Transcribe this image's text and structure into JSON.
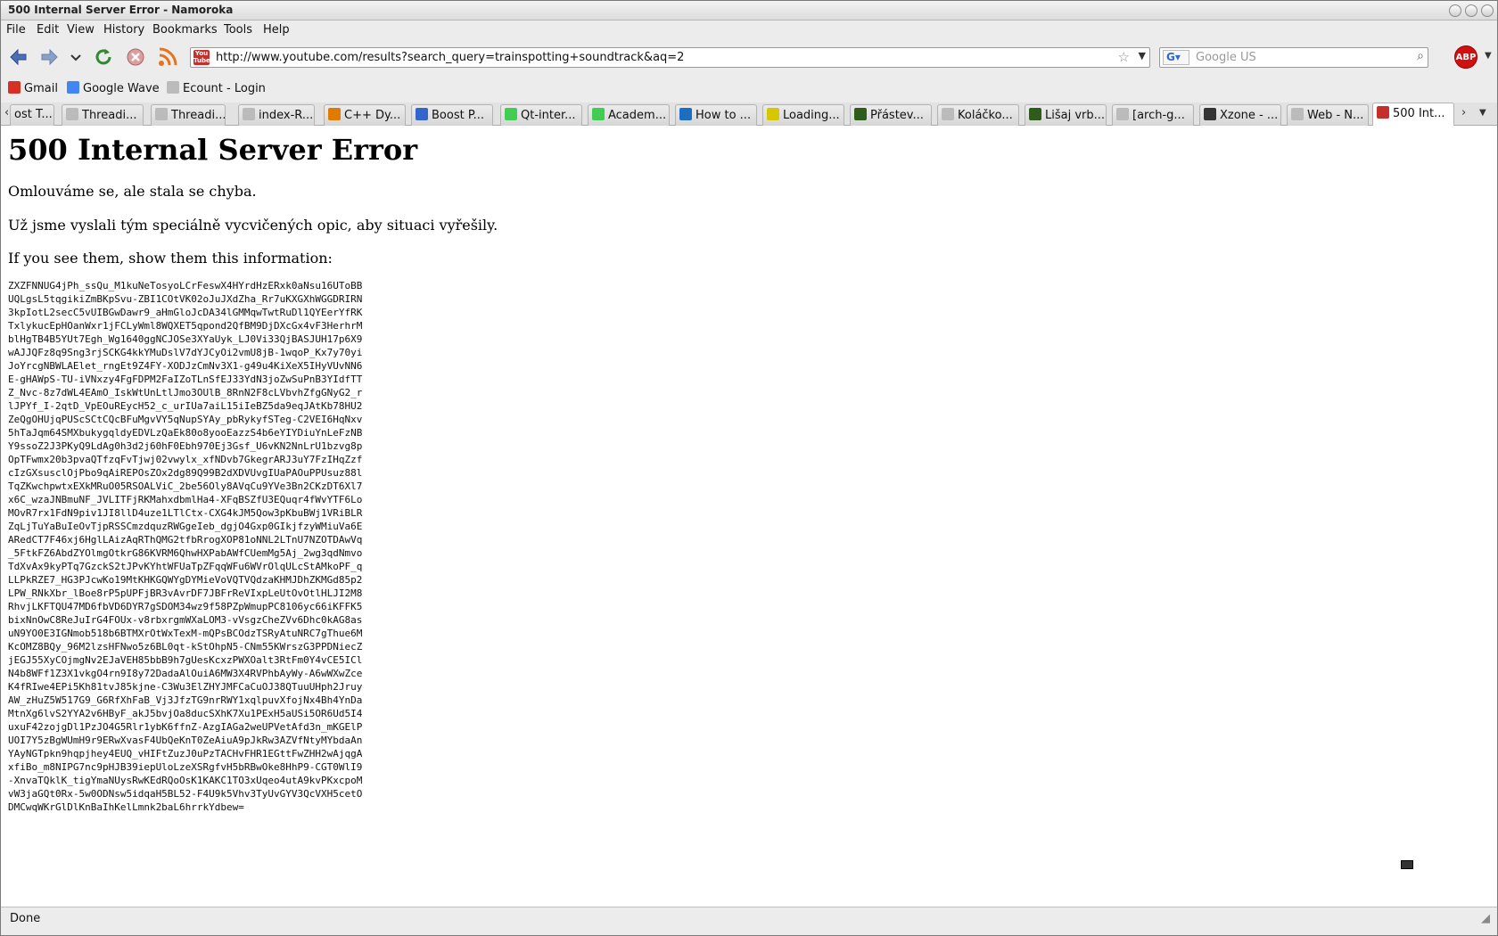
{
  "window": {
    "title": "500 Internal Server Error - Namoroka"
  },
  "menu": {
    "file": "File",
    "edit": "Edit",
    "view": "View",
    "history": "History",
    "bookmarks": "Bookmarks",
    "tools": "Tools",
    "help": "Help"
  },
  "nav": {
    "url": "http://www.youtube.com/results?search_query=trainspotting+soundtrack&aq=2",
    "search_placeholder": "Google US",
    "adblock_label": "ABP"
  },
  "bookmarks": [
    {
      "label": "Gmail",
      "icon": "gmail-icon",
      "color": "#d93025"
    },
    {
      "label": "Google Wave",
      "icon": "google-wave-icon",
      "color": "#4285f4"
    },
    {
      "label": "Ecount - Login",
      "icon": "page-icon",
      "color": "#888888"
    }
  ],
  "tabs": [
    {
      "label": "ost T...",
      "icon": "page-icon",
      "color": "#888888"
    },
    {
      "label": "Threadi...",
      "icon": "page-icon",
      "color": "#888888"
    },
    {
      "label": "Threadi...",
      "icon": "page-icon",
      "color": "#888888"
    },
    {
      "label": "index-R...",
      "icon": "page-icon",
      "color": "#888888"
    },
    {
      "label": "C++ Dy...",
      "icon": "stack-icon",
      "color": "#e07b00"
    },
    {
      "label": "Boost P...",
      "icon": "boost-icon",
      "color": "#3366cc"
    },
    {
      "label": "Qt-inter...",
      "icon": "qt-icon",
      "color": "#41cd52"
    },
    {
      "label": "Academ...",
      "icon": "qt-icon",
      "color": "#41cd52"
    },
    {
      "label": "How to ...",
      "icon": "kde-icon",
      "color": "#1d6dc2"
    },
    {
      "label": "Loading...",
      "icon": "loading-icon",
      "color": "#d8c600"
    },
    {
      "label": "Přástev...",
      "icon": "site-icon",
      "color": "#2e5d1b"
    },
    {
      "label": "Koláčko...",
      "icon": "page-icon",
      "color": "#888888"
    },
    {
      "label": "Lišaj vrb...",
      "icon": "site-icon",
      "color": "#2e5d1b"
    },
    {
      "label": "[arch-g...",
      "icon": "page-icon",
      "color": "#888888"
    },
    {
      "label": "Xzone - ...",
      "icon": "xzone-icon",
      "color": "#333333"
    },
    {
      "label": "Web - N...",
      "icon": "page-icon",
      "color": "#888888"
    },
    {
      "label": "500 Int...",
      "icon": "youtube-icon",
      "color": "#c4302b"
    }
  ],
  "page": {
    "heading": "500 Internal Server Error",
    "p1": "Omlouváme se, ale stala se chyba.",
    "p2": "Už jsme vyslali tým speciálně vycvičených opic, aby situaci vyřešily.",
    "p3": "If you see them, show them this information:",
    "code": "ZXZFNNUG4jPh_ssQu_M1kuNeTosyoLCrFeswX4HYrdHzERxk0aNsu16UToBB\nUQLgsL5tqgikiZmBKpSvu-ZBI1COtVK02oJuJXdZha_Rr7uKXGXhWGGDRIRN\n3kpIotL2secC5vUIBGwDawr9_aHmGloJcDA34lGMMqwTwtRuDl1QYEerYfRK\nTxlykucEpHOanWxr1jFCLyWml8WQXET5qpond2QfBM9DjDXcGx4vF3HerhrM\nblHgTB4B5YUt7Egh_Wg1640ggNCJOSe3XYaUyk_LJ0Vi33QjBASJUH17p6X9\nwAJJQFz8q9Sng3rjSCKG4kkYMuDslV7dYJCyOi2vmU8jB-1wqoP_Kx7y70yi\nJoYrcgNBWLAElet_rngEt9Z4FY-XODJzCmNv3X1-g49u4KiXeX5IHyVUvNN6\nE-gHAWpS-TU-iVNxzy4FgFDPM2FaIZoTLnSfEJ33YdN3joZwSuPnB3YIdfTT\nZ_Nvc-8z7dWL4EAmO_IskWtUnLtlJmo3OUlB_8RnN2F8cLVbvhZfgGNyG2_r\nlJPYf_I-2qtD_VpEOuREycH52_c_urIUa7aiL15iIeBZ5da9eqJAtKb78HU2\nZeQgOHUjqPUScSCtCQcBFuMgvVY5qNupSYAy_pbRykyfSTeg-C2VEI6HqNxv\n5hTaJqm64SMXbukygqldyEDVLzQaEk80o8yooEazzS4b6eYIYDiuYnLeFzNB\nY9ssoZ2J3PKyQ9LdAg0h3d2j60hF0Ebh970Ej3Gsf_U6vKN2NnLrU1bzvg8p\nOpTFwmx20b3pvaQTfzqFvTjwj02vwylx_xfNDvb7GkegrARJ3uY7FzIHqZzf\ncIzGXsusclOjPbo9qAiREPOsZOx2dg89Q99B2dXDVUvgIUaPAOuPPUsuz88l\nTqZKwchpwtxEXkMRuO05RSOALViC_2be56Oly8AVqCu9YVe3Bn2CKzDT6Xl7\nx6C_wzaJNBmuNF_JVLITFjRKMahxdbmlHa4-XFqBSZfU3EQuqr4fWvYTF6Lo\nMOvR7rx1FdN9piv1JI8llD4uze1LTlCtx-CXG4kJM5Qow3pKbuBWj1VRiBLR\nZqLjTuYaBuIeOvTjpRSSCmzdquzRWGgeIeb_dgjO4Gxp0GIkjfzyWMiuVa6E\nARedCT7F46xj6HglLAizAqRThQMG2tfbRrogXOP81oNNL2LTnU7NZOTDAwVq\n_5FtkFZ6AbdZYOlmgOtkrG86KVRM6QhwHXPabAWfCUemMg5Aj_2wg3qdNmvo\nTdXvAx9kyPTq7GzckS2tJPvKYhtWFUaTpZFqqWFu6WVrOlqULcStAMkoPF_q\nLLPkRZE7_HG3PJcwKo19MtKHKGQWYgDYMieVoVQTVQdzaKHMJDhZKMGd85p2\nLPW_RNkXbr_lBoe8rP5pUPFjBR3vAvrDF7JBFrReVIxpLeUtOvOtlHLJI2M8\nRhvjLKFTQU47MD6fbVD6DYR7gSDOM34wz9f58PZpWmupPC8106yc66iKFFK5\nbixNnOwC8ReJuIrG4FOUx-v8rbxrgmWXaLOM3-vVsgzCheZVv6Dhc0kAG8as\nuN9YO0E3IGNmob518b6BTMXrOtWxTexM-mQPsBCOdzTSRyAtuNRC7gThue6M\nKcOMZ8BQy_96M2lzsHFNwo5z6BL0qt-kStOhpN5-CNm55KWrszG3PPDNiecZ\njEGJ55XyCOjmgNv2EJaVEH85bbB9h7gUesKcxzPWXOalt3RtFm0Y4vCE5ICl\nN4b8WFf1Z3X1vkgO4rn9I8y72DadaAlOuiA6MW3X4RVPhbAyWy-A6wWXwZce\nK4fRIwe4EPi5Kh81tvJ85kjne-C3Wu3ElZHYJMFCaCuOJ38QTuuUHph2Jruy\nAW_zHuZ5W517G9_G6RfXhFaB_Vj3JfzTG9nrRWY1xqlpuvXfojNx4Bh4YnDa\nMtnXg6lvS2YYA2v6HByF_akJ5bvjOa8ducSXhK7Xu1PExH5aUSi5OR6Ud5I4\nuxuF42zojgDl1PzJO4G5Rlr1ybK6ffnZ-AzgIAGa2weUPVetAfd3n_mKGElP\nUOI7Y5zBgWUmH9r9ERwXvasF4UbQeKnT0ZeAiuA9pJkRw3AZVfNtyMYbdaAn\nYAyNGTpkn9hqpjhey4EUQ_vHIFtZuzJ0uPzTACHvFHR1EGttFwZHH2wAjqgA\nxfiBo_m8NIPG7nc9pHJB39iepUloLzeXSRgfvH5bRBwOke8HhP9-CGT0WlI9\n-XnvaTQklK_tigYmaNUysRwKEdRQoOsK1KAKC1TO3xUqeo4utA9kvPKxcpoM\nvW3jaGQt0Rx-5w0ODNsw5idqaH5BL52-F4U9k5Vhv3TyUvGYV3QcVXH5cetO\nDMCwqWKrGlDlKnBaIhKelLmnk2baL6hrrkYdbew="
  },
  "status": {
    "text": "Done"
  }
}
